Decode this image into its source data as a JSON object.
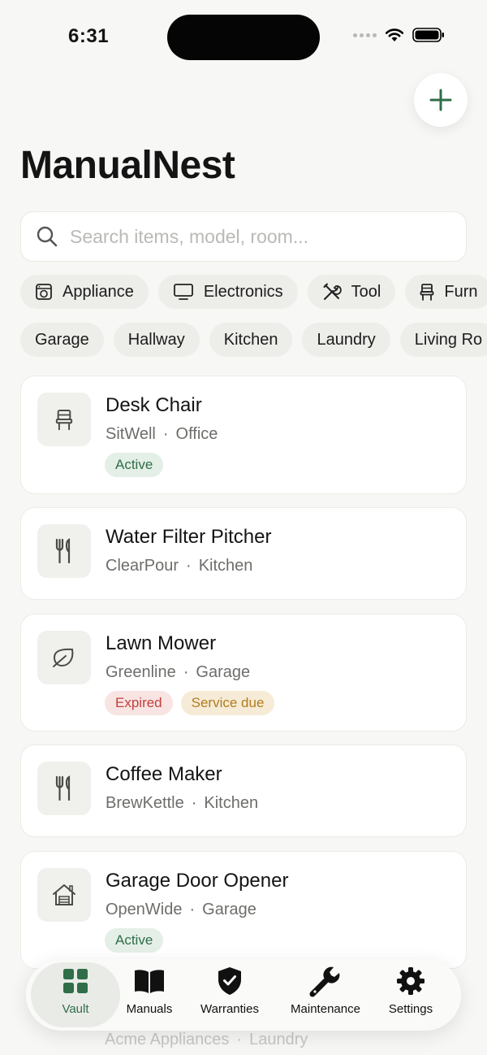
{
  "status_bar": {
    "time": "6:31"
  },
  "header": {
    "title": "ManualNest",
    "add_icon": "plus-icon"
  },
  "search": {
    "placeholder": "Search items, model, room..."
  },
  "categories": [
    {
      "label": "Appliance",
      "icon": "appliance-icon"
    },
    {
      "label": "Electronics",
      "icon": "monitor-icon"
    },
    {
      "label": "Tool",
      "icon": "tools-icon"
    },
    {
      "label": "Furn",
      "icon": "chair-icon"
    }
  ],
  "rooms": [
    "Garage",
    "Hallway",
    "Kitchen",
    "Laundry",
    "Living Ro"
  ],
  "items": [
    {
      "title": "Desk Chair",
      "brand": "SitWell",
      "room": "Office",
      "icon": "chair-icon",
      "badges": [
        {
          "label": "Active",
          "kind": "active"
        }
      ]
    },
    {
      "title": "Water Filter Pitcher",
      "brand": "ClearPour",
      "room": "Kitchen",
      "icon": "utensils-icon",
      "badges": []
    },
    {
      "title": "Lawn Mower",
      "brand": "Greenline",
      "room": "Garage",
      "icon": "leaf-icon",
      "badges": [
        {
          "label": "Expired",
          "kind": "expired"
        },
        {
          "label": "Service due",
          "kind": "service"
        }
      ]
    },
    {
      "title": "Coffee Maker",
      "brand": "BrewKettle",
      "room": "Kitchen",
      "icon": "utensils-icon",
      "badges": []
    },
    {
      "title": "Garage Door Opener",
      "brand": "OpenWide",
      "room": "Garage",
      "icon": "house-icon",
      "badges": [
        {
          "label": "Active",
          "kind": "active"
        }
      ]
    }
  ],
  "partial_item": {
    "brand": "Acme Appliances",
    "room": "Laundry"
  },
  "separator": "·",
  "tabs": [
    {
      "label": "Vault",
      "icon": "grid-icon",
      "selected": true
    },
    {
      "label": "Manuals",
      "icon": "book-icon",
      "selected": false
    },
    {
      "label": "Warranties",
      "icon": "shield-check-icon",
      "selected": false
    },
    {
      "label": "Maintenance",
      "icon": "wrench-icon",
      "selected": false
    },
    {
      "label": "Settings",
      "icon": "gear-icon",
      "selected": false
    }
  ],
  "colors": {
    "accent": "#2f6e48",
    "background": "#f7f7f5",
    "expired": "#c0413c",
    "service_due": "#b07d20"
  }
}
